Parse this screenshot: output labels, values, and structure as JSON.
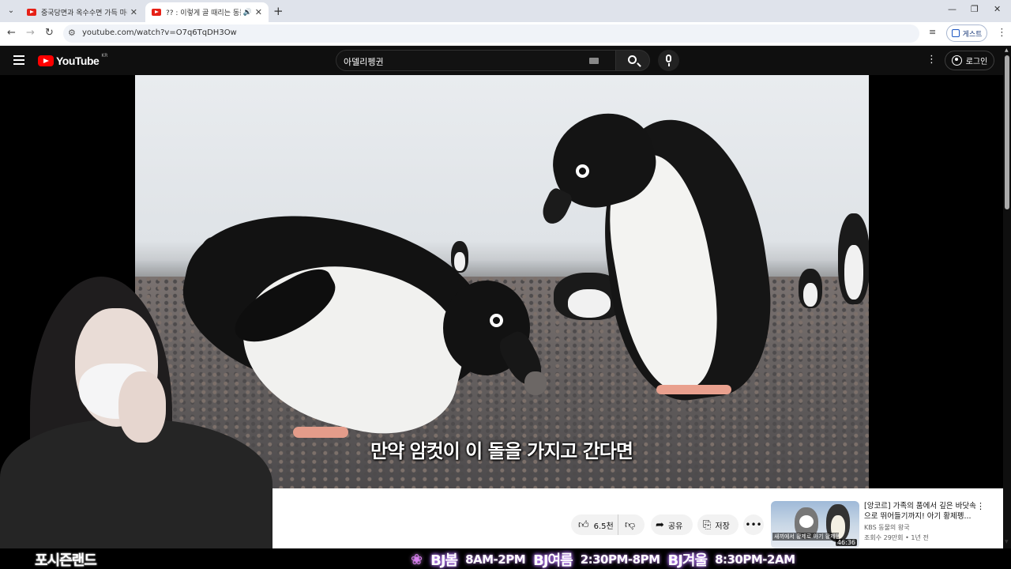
{
  "browser": {
    "tabs": [
      {
        "title": "중국당면과 옥수수면 가득 마라",
        "active": false
      },
      {
        "title": "?? : 이렇게 골 때리는 동물",
        "active": true
      }
    ],
    "tab_dropdown_icon": "chevron-down",
    "new_tab_icon": "+",
    "window_controls": [
      "—",
      "❐",
      "✕"
    ],
    "url": "youtube.com/watch?v=O7q6TqDH3Ow",
    "profile_label": "게스트",
    "menu_icon": "⋮"
  },
  "youtube": {
    "logo_text": "YouTube",
    "region": "KR",
    "search_query": "아델리펭귄",
    "signin_label": "로그인"
  },
  "video": {
    "subtitle": "만약 암컷이 이 돌을 가지고 간다면"
  },
  "actions": {
    "like_count": "6.5천",
    "share_label": "공유",
    "save_label": "저장"
  },
  "recommendation": {
    "title": "[앙코르] 가족의 품에서 깊은 바닷속으로 뛰어들기까지! 아기 황제펭...",
    "channel": "KBS 동물의 왕국",
    "meta": "조회수 29만회 • 1년 전",
    "duration": "46:36",
    "thumb_caption": "새끼에서 황제로 아기 황제펭귄의 성장기"
  },
  "overlay": {
    "brand": "포시즌랜드",
    "schedule": [
      {
        "name": "BJ봄",
        "time": "8AM-2PM"
      },
      {
        "name": "BJ여름",
        "time": "2:30PM-8PM"
      },
      {
        "name": "BJ겨울",
        "time": "8:30PM-2AM"
      }
    ]
  },
  "colors": {
    "youtube_red": "#ff0000",
    "masthead_bg": "#0f0f0f",
    "overlay_glow": "#c98bff"
  }
}
